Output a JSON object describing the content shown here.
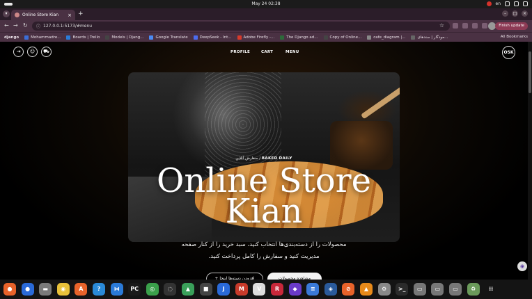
{
  "os": {
    "clock": "May 24  02:38",
    "lang": "en"
  },
  "browser": {
    "tab_title": "Online Store Kian",
    "new_tab": "+",
    "url": "127.0.0.1:5173/#menu",
    "update_label": "Finish update",
    "bookmarks_first": "django",
    "bookmarks": [
      {
        "label": "Mohammadre...",
        "color": "#3b6ed8"
      },
      {
        "label": "Boards | Trello",
        "color": "#2a7cd8"
      },
      {
        "label": "Models | Djang...",
        "color": "#444"
      },
      {
        "label": "Google Translate",
        "color": "#4a8af4"
      },
      {
        "label": "DeepSeek - Int...",
        "color": "#4b6cf0"
      },
      {
        "label": "Adobe Firefly -...",
        "color": "#d83a2a"
      },
      {
        "label": "The Django ad...",
        "color": "#2d6a3a"
      },
      {
        "label": "Copy of Online...",
        "color": "#444"
      },
      {
        "label": "cafe_diagram |...",
        "color": "#888"
      },
      {
        "label": "مودگار | سندهای...",
        "color": "#666"
      }
    ],
    "all_bookmarks": "All Bookmarks"
  },
  "header": {
    "nav": [
      "PROFILE",
      "CART",
      "MENU"
    ],
    "lang_button": "OSK",
    "icons": [
      "logout-icon",
      "user-icon",
      "cart-icon"
    ]
  },
  "hero": {
    "eyebrow_brand": "BAKED DAILY",
    "eyebrow_fa": "سفارش آنلاین",
    "title_line1": "Online Store",
    "title_line2": "Kian"
  },
  "description": {
    "line1": "محصولات را از دسته‌بندی‌ها انتخاب کنید، سبد خرید را از کنار صفحه",
    "line2": "مدیریت کنید و سفارش را کامل پرداخت کنید."
  },
  "buttons": {
    "secondary": "+ افزودن دسته‌ها اینجا",
    "primary": "مشاهده محصولات"
  },
  "dock": [
    {
      "name": "firefox-icon",
      "color": "#e8632a",
      "glyph": "●"
    },
    {
      "name": "thunderbird-icon",
      "color": "#2a6ad8",
      "glyph": "●"
    },
    {
      "name": "files-icon",
      "color": "#7a7a7a",
      "glyph": "▬"
    },
    {
      "name": "rhythmbox-icon",
      "color": "#e8c13a",
      "glyph": "◉"
    },
    {
      "name": "software-icon",
      "color": "#e8632a",
      "glyph": "A"
    },
    {
      "name": "help-icon",
      "color": "#2a8ad8",
      "glyph": "?"
    },
    {
      "name": "vscode-icon",
      "color": "#2a7ad8",
      "glyph": "⋈"
    },
    {
      "name": "pycharm-icon",
      "color": "#1a1a1a",
      "glyph": "PC"
    },
    {
      "name": "chrome-icon",
      "color": "#3aa04a",
      "glyph": "◎"
    },
    {
      "name": "obs-icon",
      "color": "#333",
      "glyph": "◌"
    },
    {
      "name": "image-viewer-icon",
      "color": "#3aa05a",
      "glyph": "▲"
    },
    {
      "name": "camera-icon",
      "color": "#444",
      "glyph": "■"
    },
    {
      "name": "joplin-icon",
      "color": "#2a6ad8",
      "glyph": "J"
    },
    {
      "name": "mendeley-icon",
      "color": "#c83a2a",
      "glyph": "M"
    },
    {
      "name": "inkscape-icon",
      "color": "#ddd",
      "glyph": "V"
    },
    {
      "name": "rider-icon",
      "color": "#c8283a",
      "glyph": "R"
    },
    {
      "name": "obsidian-icon",
      "color": "#6a3ac8",
      "glyph": "◆"
    },
    {
      "name": "notes-icon",
      "color": "#3a7ad8",
      "glyph": "≡"
    },
    {
      "name": "pgadmin-icon",
      "color": "#2a5a9a",
      "glyph": "◈"
    },
    {
      "name": "postman-icon",
      "color": "#e8632a",
      "glyph": "⊘"
    },
    {
      "name": "vlc-icon",
      "color": "#e88a1a",
      "glyph": "▲"
    },
    {
      "name": "settings-icon",
      "color": "#888",
      "glyph": "⚙"
    },
    {
      "name": "terminal-icon",
      "color": "#2b2b2b",
      "glyph": ">_"
    },
    {
      "name": "app-window-icon",
      "color": "#777",
      "glyph": "▭"
    },
    {
      "name": "app-window-icon-2",
      "color": "#777",
      "glyph": "▭"
    },
    {
      "name": "app-window-icon-3",
      "color": "#777",
      "glyph": "▭"
    },
    {
      "name": "trash-icon",
      "color": "#6a9a5a",
      "glyph": "♻"
    },
    {
      "name": "show-apps-icon",
      "color": "#141414",
      "glyph": "⁞⁞"
    }
  ]
}
